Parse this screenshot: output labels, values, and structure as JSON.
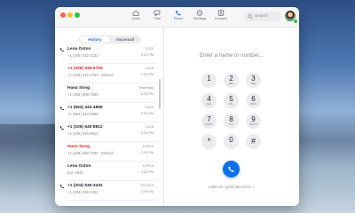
{
  "nav": {
    "tabs": [
      {
        "label": "Home",
        "icon": "home-icon"
      },
      {
        "label": "Chat",
        "icon": "chat-icon"
      },
      {
        "label": "Phone",
        "icon": "phone-icon",
        "active": true
      },
      {
        "label": "Meetings",
        "icon": "clock-icon"
      },
      {
        "label": "Contacts",
        "icon": "contacts-icon"
      }
    ],
    "search_placeholder": "Search"
  },
  "segments": {
    "history": "History",
    "voicemail": "Voicemail"
  },
  "calls": [
    {
      "name": "Lena Oxton",
      "number": "+1 (206) 232-3232",
      "date": "12/22",
      "time": "2:34 PM",
      "type": "outgoing",
      "missed": false
    },
    {
      "name": "+1 (408) 345-6753",
      "number": "+1 (408) 345-6753 · Missed",
      "date": "11/18",
      "time": "2:34 PM",
      "type": "missed",
      "missed": true
    },
    {
      "name": "Hana Song",
      "number": "+1 (408) 568-7530",
      "date": "Yesterday",
      "time": "2:34 PM",
      "type": "incoming",
      "missed": false
    },
    {
      "name": "+1 (953) 343-4895",
      "number": "+1 (953) 343-4895",
      "date": "12/10",
      "time": "2:34 PM",
      "type": "outgoing",
      "missed": false
    },
    {
      "name": "+1 (106) 640-8812",
      "number": "+1 (106) 640-8812",
      "date": "12/18",
      "time": "2:34 PM",
      "type": "outgoing",
      "missed": false
    },
    {
      "name": "Hana Song",
      "number": "+1 (408) 568-7530 · Missed",
      "date": "12/9/19",
      "time": "2:34 PM",
      "type": "missed",
      "missed": true
    },
    {
      "name": "Lena Oxton",
      "number": "Ext. 2846",
      "date": "12/5/19",
      "time": "2:34 PM",
      "type": "incoming",
      "missed": false
    },
    {
      "name": "+1 (204) 536-3432",
      "number": "+1 (204) 536-3432",
      "date": "12/13/19",
      "time": "2:34 PM",
      "type": "outgoing",
      "missed": false
    }
  ],
  "dialpad": {
    "placeholder": "Enter a name or number...",
    "keys": [
      {
        "digit": "1",
        "letters": ""
      },
      {
        "digit": "2",
        "letters": "ABC"
      },
      {
        "digit": "3",
        "letters": "DEF"
      },
      {
        "digit": "4",
        "letters": "GHI"
      },
      {
        "digit": "5",
        "letters": "JKL"
      },
      {
        "digit": "6",
        "letters": "MNO"
      },
      {
        "digit": "7",
        "letters": "PQRS"
      },
      {
        "digit": "8",
        "letters": "TUV"
      },
      {
        "digit": "9",
        "letters": "WXYZ"
      },
      {
        "digit": "*",
        "letters": ""
      },
      {
        "digit": "0",
        "letters": "+"
      },
      {
        "digit": "#",
        "letters": ""
      }
    ],
    "caller_id": "Caller ID: (223) 252-2219 ⌄"
  },
  "colors": {
    "accent": "#0e71eb",
    "missed": "#e02828"
  }
}
